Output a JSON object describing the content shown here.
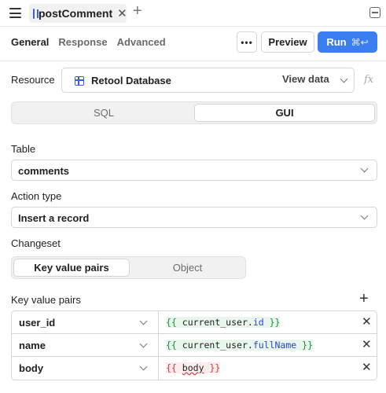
{
  "topbar": {
    "tab_label": "postComment",
    "tab_close": "✕",
    "add_tab": "+"
  },
  "subtabs": [
    {
      "label": "General",
      "active": true
    },
    {
      "label": "Response",
      "active": false
    },
    {
      "label": "Advanced",
      "active": false
    }
  ],
  "toolbar": {
    "more_label": "•••",
    "preview_label": "Preview",
    "run_label": "Run",
    "run_shortcut": "⌘↩",
    "accent_color": "#3b7ef0"
  },
  "resource": {
    "label": "Resource",
    "value": "Retool Database",
    "view_data": "View data",
    "fx": "fx"
  },
  "mode_toggle": {
    "options": [
      "SQL",
      "GUI"
    ],
    "selected": "GUI"
  },
  "table": {
    "label": "Table",
    "value": "comments"
  },
  "action_type": {
    "label": "Action type",
    "value": "Insert a record"
  },
  "changeset": {
    "label": "Changeset",
    "options": [
      "Key value pairs",
      "Object"
    ],
    "selected": "Key value pairs"
  },
  "kv": {
    "label": "Key value pairs",
    "add": "+",
    "rows": [
      {
        "key": "user_id",
        "open": "{{",
        "path": "current_user.",
        "prop": "id",
        "close": "}}",
        "valid": true
      },
      {
        "key": "name",
        "open": "{{",
        "path": "current_user.",
        "prop": "fullName",
        "close": "}}",
        "valid": true
      },
      {
        "key": "body",
        "open": "{{",
        "path": "body",
        "prop": "",
        "close": "}}",
        "valid": false
      }
    ],
    "delete_glyph": "✕"
  }
}
